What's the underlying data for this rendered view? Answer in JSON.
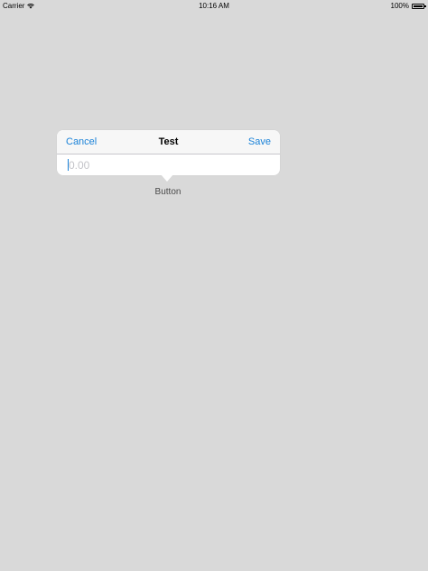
{
  "status_bar": {
    "carrier": "Carrier",
    "time": "10:16 AM",
    "battery": "100%"
  },
  "popover": {
    "cancel_label": "Cancel",
    "title": "Test",
    "save_label": "Save",
    "input_value": "",
    "input_placeholder": "0.00"
  },
  "anchor_button": {
    "label": "Button"
  },
  "colors": {
    "background": "#d9d9d9",
    "accent": "#1a82d8",
    "popover": "#ffffff"
  },
  "icons": [
    "wifi-icon",
    "battery-icon"
  ]
}
